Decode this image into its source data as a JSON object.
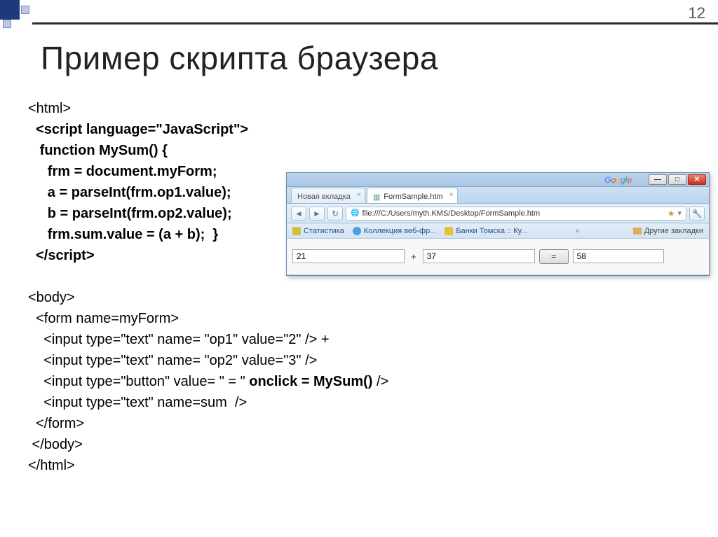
{
  "page_number": "12",
  "slide_title": "Пример скрипта браузера",
  "code": {
    "l1": "<html>",
    "l2": "  <script language=\"JavaScript\">",
    "l3": "   function MySum() {",
    "l4": "     frm = document.myForm;",
    "l5": "     a = parseInt(frm.op1.value);",
    "l6": "     b = parseInt(frm.op2.value);",
    "l7": "     frm.sum.value = (a + b);  }",
    "l8": "  </scr",
    "l8b": "ipt>",
    "l9": "<body>",
    "l10": "  <form name=myForm>",
    "l11": "    <input type=\"text\" name= \"op1\" value=\"2\" /> +",
    "l12": "    <input type=\"text\" name= \"op2\" value=\"3\" />",
    "l13a": "    <input type=\"button\" value= \" = \" ",
    "l13b": "onclick = MySum()",
    "l13c": " />",
    "l14": "    <input type=\"text\" name=sum  />",
    "l15": "  </form>",
    "l16": " </body>",
    "l17": "</html>"
  },
  "browser": {
    "google": "Google",
    "tab_new": "Новая вкладка",
    "tab_active": "FormSample.htm",
    "url": "file:///C:/Users/myth.KMS/Desktop/FormSample.htm",
    "bookmarks": {
      "b1": "Статистика",
      "b2": "Коллекция веб-фр...",
      "b3": "Банки Томска :: Ку...",
      "other": "Другие закладки",
      "more": "»"
    },
    "form": {
      "op1": "21",
      "plus": "+",
      "op2": "37",
      "eq": "=",
      "sum": "58"
    },
    "win": {
      "min": "—",
      "max": "□",
      "close": "✕"
    },
    "nav": {
      "back": "◄",
      "fwd": "►",
      "reload": "↻"
    }
  }
}
